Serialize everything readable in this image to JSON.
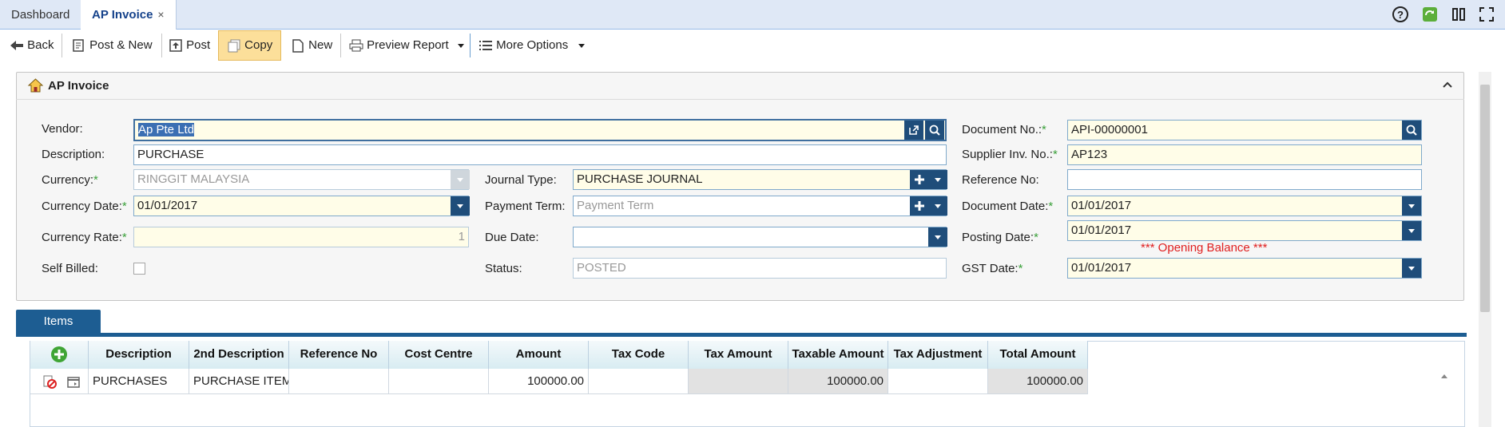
{
  "tabs": [
    {
      "label": "Dashboard"
    },
    {
      "label": "AP Invoice",
      "close": "×"
    }
  ],
  "toolbar": {
    "back": "Back",
    "post_new": "Post & New",
    "post": "Post",
    "copy": "Copy",
    "new": "New",
    "preview": "Preview Report",
    "more": "More Options"
  },
  "panel": {
    "title": "AP Invoice"
  },
  "form": {
    "vendor": {
      "label": "Vendor:",
      "value": "Ap Pte Ltd"
    },
    "description": {
      "label": "Description:",
      "value": "PURCHASE"
    },
    "currency": {
      "label": "Currency:",
      "value": "RINGGIT MALAYSIA"
    },
    "currency_date": {
      "label": "Currency Date:",
      "value": "01/01/2017"
    },
    "currency_rate": {
      "label": "Currency Rate:",
      "value": "1"
    },
    "self_billed": {
      "label": "Self Billed:"
    },
    "journal_type": {
      "label": "Journal Type:",
      "value": "PURCHASE JOURNAL"
    },
    "payment_term": {
      "label": "Payment Term:",
      "placeholder": "Payment Term"
    },
    "due_date": {
      "label": "Due Date:",
      "value": ""
    },
    "status": {
      "label": "Status:",
      "value": "POSTED"
    },
    "document_no": {
      "label": "Document No.:",
      "value": "API-00000001"
    },
    "supplier_inv_no": {
      "label": "Supplier Inv. No.:",
      "value": "AP123"
    },
    "reference_no": {
      "label": "Reference No:",
      "value": ""
    },
    "document_date": {
      "label": "Document Date:",
      "value": "01/01/2017"
    },
    "posting_date": {
      "label": "Posting Date:",
      "value": "01/01/2017"
    },
    "opening_balance": "*** Opening Balance ***",
    "gst_date": {
      "label": "GST Date:",
      "value": "01/01/2017"
    },
    "required_mark": "*"
  },
  "items": {
    "tab_label": "Items",
    "columns": [
      "Description",
      "2nd Description",
      "Reference No",
      "Cost Centre",
      "Amount",
      "Tax Code",
      "Tax Amount",
      "Taxable Amount",
      "Tax Adjustment",
      "Total Amount"
    ],
    "rows": [
      {
        "description": "PURCHASES",
        "second_description": "PURCHASE ITEM",
        "reference_no": "",
        "cost_centre": "",
        "amount": "100000.00",
        "tax_code": "",
        "tax_amount": "",
        "taxable_amount": "100000.00",
        "tax_adjustment": "",
        "total_amount": "100000.00"
      }
    ]
  },
  "colors": {
    "accent": "#1d5d92",
    "copy_highlight": "#fcdf9a",
    "required": "#3aa03a",
    "warning": "#e02020"
  }
}
